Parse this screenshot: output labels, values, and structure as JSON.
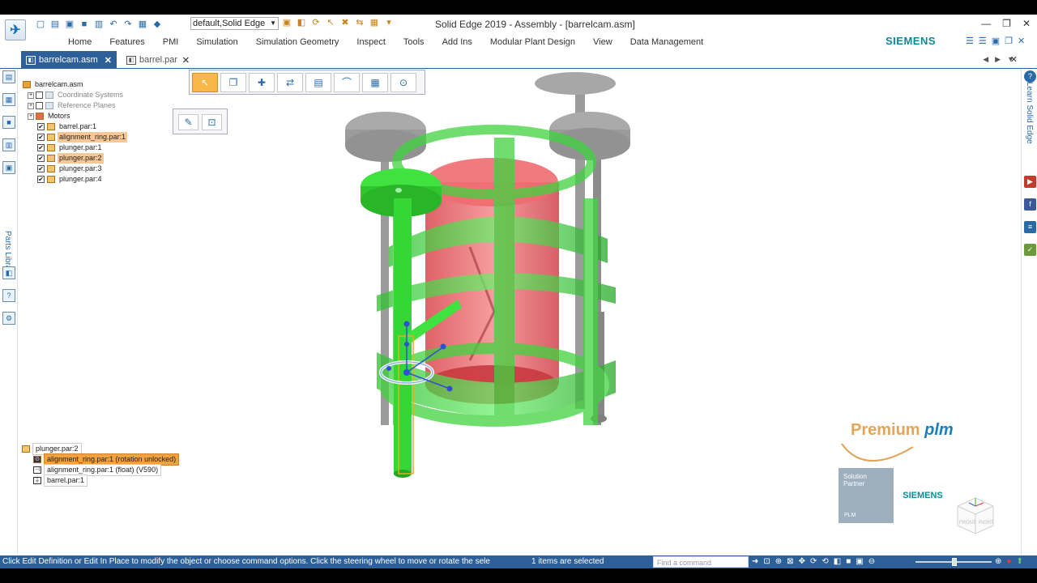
{
  "window": {
    "title": "Solid Edge 2019 - Assembly - [barrelcam.asm]",
    "theme_value": "default,Solid Edge"
  },
  "ribbon": {
    "tabs": [
      "Home",
      "Features",
      "PMI",
      "Simulation",
      "Simulation Geometry",
      "Inspect",
      "Tools",
      "Add Ins",
      "Modular Plant Design",
      "View",
      "Data Management"
    ],
    "brand": "SIEMENS"
  },
  "documents": {
    "active": "barrelcam.asm",
    "inactive": "barrel.par"
  },
  "left_rail": {
    "parts_library_label": "Parts Library"
  },
  "right_rail": {
    "learn_label": "Learn Solid Edge"
  },
  "tree": {
    "root": "barrelcam.asm",
    "items": [
      {
        "label": "Coordinate Systems",
        "kind": "ref"
      },
      {
        "label": "Reference Planes",
        "kind": "ref"
      },
      {
        "label": "Motors",
        "kind": "folder"
      },
      {
        "label": "barrel.par:1",
        "kind": "part",
        "checked": true,
        "highlight": false
      },
      {
        "label": "alignment_ring.par:1",
        "kind": "part",
        "checked": true,
        "highlight": true
      },
      {
        "label": "plunger.par:1",
        "kind": "part",
        "checked": true,
        "highlight": false
      },
      {
        "label": "plunger.par:2",
        "kind": "part",
        "checked": true,
        "highlight": true
      },
      {
        "label": "plunger.par:3",
        "kind": "part",
        "checked": true,
        "highlight": false
      },
      {
        "label": "plunger.par:4",
        "kind": "part",
        "checked": true,
        "highlight": false
      }
    ]
  },
  "relationships": {
    "part": "plunger.par:2",
    "rows": [
      {
        "label": "alignment_ring.par:1   (rotation unlocked)",
        "selected": true
      },
      {
        "label": "alignment_ring.par:1   (float)   (V590)",
        "selected": false
      },
      {
        "label": "barrel.par:1",
        "selected": false
      }
    ]
  },
  "branding": {
    "premium": "Premium",
    "plm": "plm",
    "solution": "Solution",
    "partner": "Partner",
    "plm_small": "PLM",
    "siemens": "SIEMENS"
  },
  "view_cube": {
    "front": "FRONT",
    "right": "RIGHT"
  },
  "status": {
    "message": "Click Edit Definition or Edit In Place to modify the object or choose command options. Click the steering wheel to move or rotate the sele",
    "selection_count": "1 items are selected",
    "find_placeholder": "Find a command"
  },
  "colors": {
    "accent": "#2d5f99",
    "part_green": "#3fd43f",
    "barrel_red": "#e8585c",
    "motor_grey": "#7e7e7e"
  }
}
